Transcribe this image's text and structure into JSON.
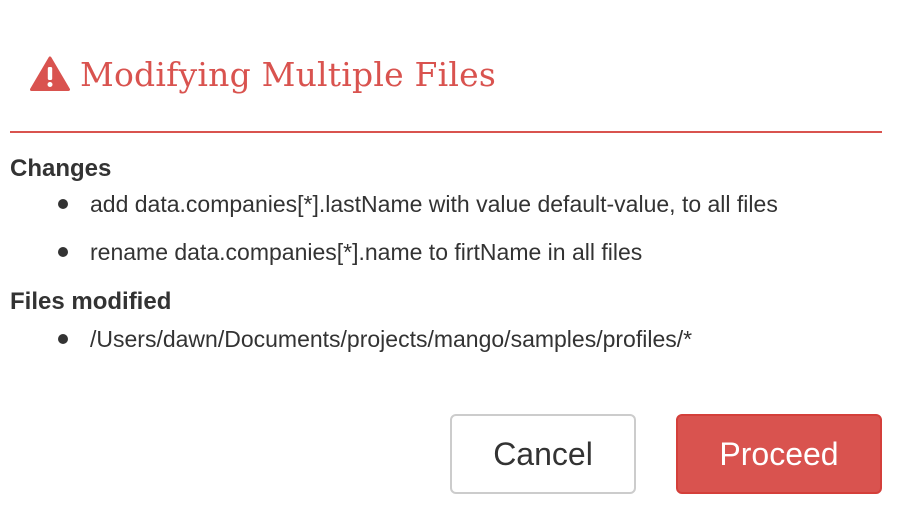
{
  "dialog": {
    "title": "Modifying Multiple Files",
    "icon": "warning-triangle-icon",
    "accent_color": "#d9534f"
  },
  "changes": {
    "heading": "Changes",
    "items": [
      "add data.companies[*].lastName with value default-value, to all files",
      "rename data.companies[*].name to firtName in all files"
    ]
  },
  "files": {
    "heading": "Files modified",
    "items": [
      "/Users/dawn/Documents/projects/mango/samples/profiles/*"
    ]
  },
  "buttons": {
    "cancel_label": "Cancel",
    "proceed_label": "Proceed"
  }
}
